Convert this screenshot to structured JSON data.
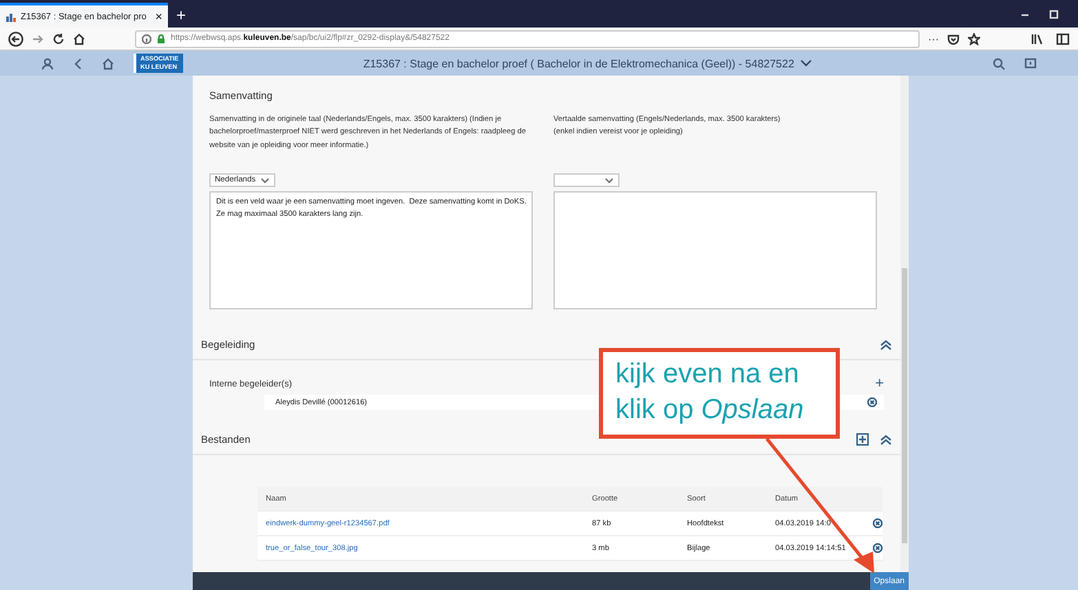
{
  "browser": {
    "tab": {
      "title": "Z15367 : Stage en bachelor pro",
      "close": "×",
      "selected": true
    },
    "new_tab": "+",
    "url": "https://webwsq.aps.**kuleuven.be**/sap/bc/ui2/flp#zr_0292-display&/54827522",
    "more": "···"
  },
  "shell": {
    "logo": [
      "ASSOCIATIE",
      "KU LEUVEN"
    ],
    "title": "Z15367 : Stage en bachelor proef ( Bachelor in de Elektromechanica (Geel)) - 54827522"
  },
  "summary": {
    "title": "Samenvatting",
    "fields": [
      {
        "label": "Samenvatting in de originele taal (Nederlands/Engels, max. 3500 karakters) (Indien je\nbachelorproef/masterproef NIET werd geschreven in het Nederlands of Engels: raadpleeg de\nwebsite van je opleiding voor meer informatie.)",
        "language": "Nederlands",
        "value": "Dit is een veld waar je een samenvatting moet ingeven.  Deze samenvatting komt in DoKS.\nZe mag maximaal 3500 karakters lang zijn."
      },
      {
        "label": "Vertaalde samenvatting (Engels/Nederlands, max. 3500 karakters)\n(enkel indien vereist voor je opleiding)"
      }
    ]
  },
  "supervision": {
    "title": "Begeleiding",
    "expanded": true,
    "label": "Interne begeleider(s)",
    "add": "+",
    "supervisors": [
      {
        "name": "Aleydis Devillé (00012616)"
      }
    ]
  },
  "files": {
    "title": "Bestanden",
    "expanded": true,
    "columns": [
      "Naam",
      "Grootte",
      "Soort",
      "Datum"
    ],
    "rows": [
      {
        "name": "eindwerk-dummy-geel-r1234567.pdf",
        "size": "87 kb",
        "type": "Hoofdtekst",
        "date": "04.03.2019 14:0"
      },
      {
        "name": "true_or_false_tour_308.jpg",
        "size": "3 mb",
        "type": "Bijlage",
        "date": "04.03.2019 14:14:51"
      }
    ]
  },
  "footer": {
    "save": "Opslaan"
  },
  "callout": {
    "text": "kijk even na en\nklik op *Opslaan*"
  }
}
